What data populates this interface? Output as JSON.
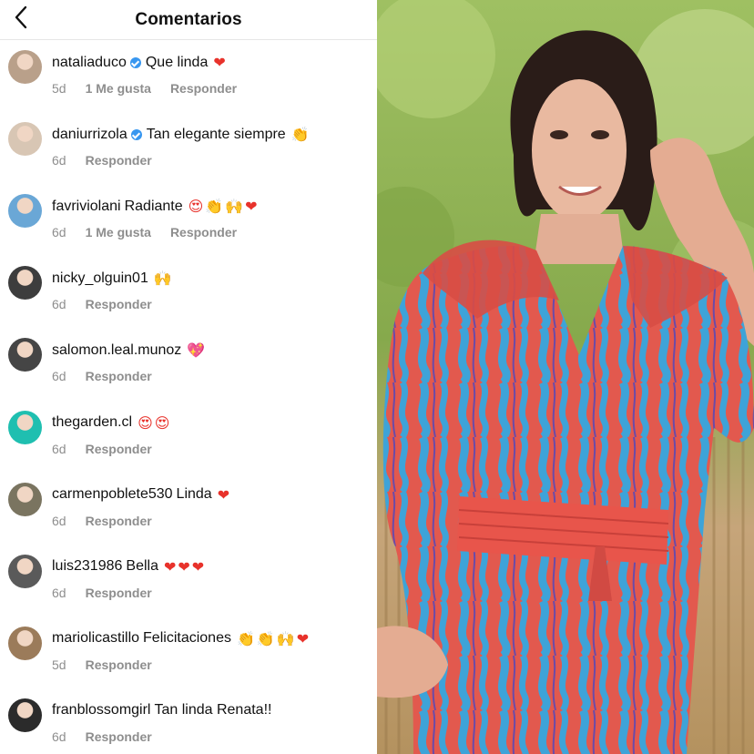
{
  "header": {
    "title": "Comentarios"
  },
  "comments": [
    {
      "username": "nataliaduco",
      "verified": true,
      "text": "Que linda",
      "emojis": "❤",
      "age": "5d",
      "likes": "1 Me gusta",
      "reply": "Responder",
      "avatar_color": "#b9a08a"
    },
    {
      "username": "daniurrizola",
      "verified": true,
      "text": "Tan elegante siempre",
      "emojis": "👏",
      "age": "6d",
      "likes": "",
      "reply": "Responder",
      "avatar_color": "#d8c6b4"
    },
    {
      "username": "favriviolani",
      "verified": false,
      "text": "Radiante",
      "emojis": "😍👏🙌❤",
      "age": "6d",
      "likes": "1 Me gusta",
      "reply": "Responder",
      "avatar_color": "#6aa7d6"
    },
    {
      "username": "nicky_olguin01",
      "verified": false,
      "text": "",
      "emojis": "🙌",
      "age": "6d",
      "likes": "",
      "reply": "Responder",
      "avatar_color": "#3d3d3d"
    },
    {
      "username": "salomon.leal.munoz",
      "verified": false,
      "text": "",
      "emojis": "💖",
      "age": "6d",
      "likes": "",
      "reply": "Responder",
      "avatar_color": "#454545"
    },
    {
      "username": "thegarden.cl",
      "verified": false,
      "text": "",
      "emojis": "😍😍",
      "age": "6d",
      "likes": "",
      "reply": "Responder",
      "avatar_color": "#1fbfb0"
    },
    {
      "username": "carmenpoblete530",
      "verified": false,
      "text": "Linda",
      "emojis": "❤",
      "age": "6d",
      "likes": "",
      "reply": "Responder",
      "avatar_color": "#7a7460"
    },
    {
      "username": "luis231986",
      "verified": false,
      "text": "Bella",
      "emojis": "❤❤❤",
      "age": "6d",
      "likes": "",
      "reply": "Responder",
      "avatar_color": "#5a5a5a"
    },
    {
      "username": "mariolicastillo",
      "verified": false,
      "text": "Felicitaciones",
      "emojis": "👏👏🙌❤",
      "age": "5d",
      "likes": "",
      "reply": "Responder",
      "avatar_color": "#9b7b5a"
    },
    {
      "username": "franblossomgirl",
      "verified": false,
      "text": "Tan linda Renata!!",
      "emojis": "",
      "age": "6d",
      "likes": "",
      "reply": "Responder",
      "avatar_color": "#2b2b2b"
    }
  ],
  "colors": {
    "heart": "#e8322b",
    "verified": "#3897f0",
    "meta_text": "#8e8e8e",
    "dress_red": "#e6574d",
    "dress_blue": "#3fa1d6"
  },
  "icons": {
    "back": "chevron-left-icon",
    "verified": "verified-badge-icon"
  }
}
